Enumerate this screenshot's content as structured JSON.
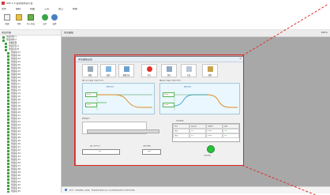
{
  "app": {
    "title": "UAT 1.0 自动化测试平台"
  },
  "menu": [
    "文件",
    "编辑",
    "视图",
    "工具",
    "窗口",
    "帮助"
  ],
  "toolbar": {
    "buttons": [
      {
        "label": "新建"
      },
      {
        "label": "打开"
      },
      {
        "label": "导入导出"
      },
      {
        "label": "运行"
      },
      {
        "label": "设置"
      }
    ]
  },
  "left_panel": {
    "header": "项目管理",
    "items": [
      "测试用例 1",
      "测试用例 2",
      "参数配置",
      "测试序列 A",
      "测试序列 B",
      "测试项 01",
      "测试项 02",
      "测试项 03",
      "测试项 04",
      "测试项 05",
      "测试项 06",
      "测试项 07",
      "测试项 08",
      "测试项 09",
      "测试项 10",
      "测试项 11",
      "测试项 12",
      "测试项 13",
      "测试项 14",
      "测试项 15",
      "测试项 16",
      "测试项 17",
      "测试项 18",
      "测试项 19",
      "测试项 20",
      "测试项 21",
      "测试项 22",
      "测试项 23",
      "测试项 24",
      "测试项 25",
      "测试项 26",
      "测试项 27",
      "测试项 28",
      "测试项 29",
      "测试项 30",
      "测试项 31",
      "测试项 32",
      "测试项 33",
      "测试项 34",
      "测试项 35",
      "测试项 36",
      "测试项 37",
      "测试项 38",
      "测试项 39",
      "测试项 40",
      "测试项 41",
      "测试项 42",
      "测试项 43",
      "测试项 44",
      "测试项 45",
      "测试项 46"
    ]
  },
  "workspace": {
    "header_label": "测试面板",
    "right_label": "100%"
  },
  "dialog": {
    "title": "测试面板设置",
    "tools": [
      "参数",
      "曲线",
      "数据记录",
      "停止",
      "保存",
      "导出",
      "帮助"
    ],
    "left_plot": {
      "title": "输入信号设置 (电压-时间)",
      "legend": "输出电压",
      "box1": "0.0V",
      "box2": "5.0V"
    },
    "right_plot": {
      "title": "输出信号设置 (电压-时间)",
      "legend": "输出电压",
      "box1": "0.0V",
      "box2": "5.0V"
    },
    "section_label": "数据设置",
    "input_field_label": "运行时间 (s)",
    "input_value": "10",
    "right_field_label": "采样间隔",
    "right_value": "100",
    "table_label": "测试结果",
    "table_headers": [
      "项目",
      "设定值",
      "测量值",
      "结果"
    ],
    "table_rows": [
      [
        "电压",
        "5.0",
        "4.98",
        "OK"
      ],
      [
        "电流",
        "1.0",
        "0.99",
        "OK"
      ]
    ],
    "run_label": "开始测试"
  },
  "statusbar": {
    "text": "提示: 测试面板已加载，请设置参数后点击开始测试按钮运行自动化测试。"
  },
  "colors": {
    "accent_red": "#e02020",
    "go_green": "#27c33a",
    "panel_blue": "#eaf7ff"
  }
}
